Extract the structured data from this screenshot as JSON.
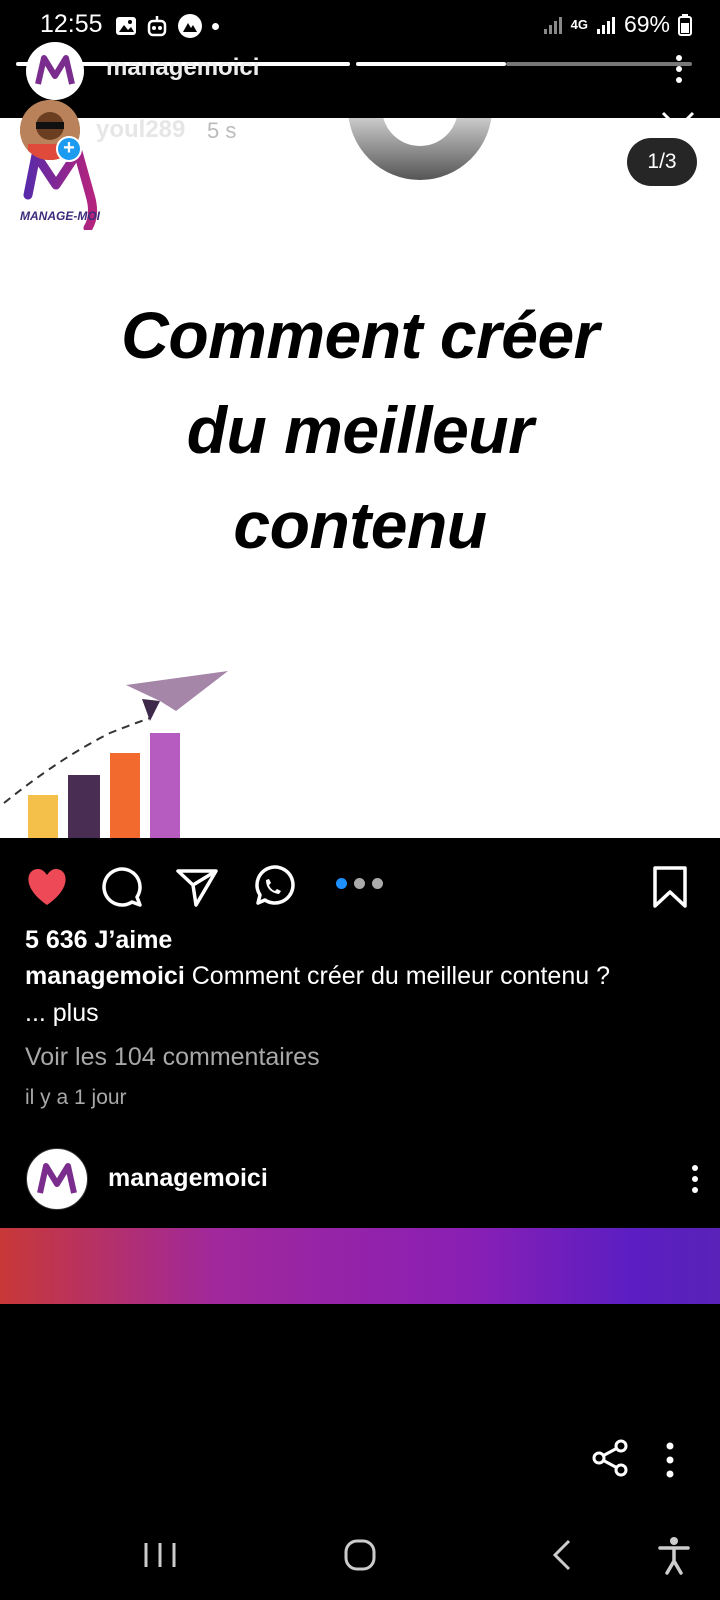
{
  "status_bar": {
    "time": "12:55",
    "network": "4G",
    "battery": "69%"
  },
  "story_header": {
    "username": "managemoici"
  },
  "post": {
    "reposter": {
      "username": "youl289",
      "time": "5 s"
    },
    "counter": "1/3",
    "image": {
      "logo_text": "MANAGE-MOI",
      "headline_lines": [
        "Comment créer",
        "du meilleur",
        "contenu"
      ]
    },
    "likes": "5 636 J’aime",
    "caption": {
      "username": "managemoici",
      "text": "Comment créer du meilleur contenu ?",
      "more": "... plus"
    },
    "comments_link": "Voir les 104 commentaires",
    "timestamp": "il y a 1 jour",
    "carousel": {
      "total": 3,
      "active_index": 0
    },
    "colors": {
      "like": "#ed4956",
      "active_dot": "#1e90ff"
    }
  },
  "next_post": {
    "username": "managemoici"
  },
  "icons": [
    "heart-icon",
    "comment-icon",
    "send-icon",
    "whatsapp-icon",
    "bookmark-icon",
    "share-icon",
    "more-icon",
    "close-icon"
  ]
}
